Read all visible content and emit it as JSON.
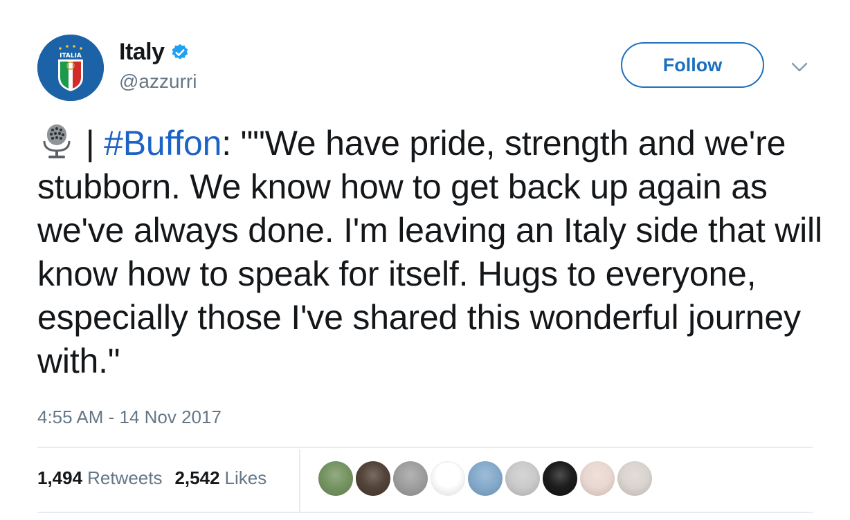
{
  "account": {
    "display_name": "Italy",
    "handle": "@azzurri",
    "avatar_text": "ITALIA",
    "verified_color": "#1da1f2"
  },
  "follow_button": {
    "label": "Follow"
  },
  "tweet": {
    "prefix": " | ",
    "hashtag": "#Buffon",
    "body": ": \"\"We have pride, strength and we're stubborn. We know how to get back up again as we've always done. I'm leaving an Italy side that will know how to speak for itself. Hugs to everyone, especially those I've shared this wonderful journey with.\"",
    "timestamp": "4:55 AM - 14 Nov 2017"
  },
  "stats": {
    "retweets_count": "1,494",
    "retweets_label": "Retweets",
    "likes_count": "2,542",
    "likes_label": "Likes"
  },
  "liker_avatars": [
    {
      "name": "liker-avatar-1",
      "color": "#6f8f5a"
    },
    {
      "name": "liker-avatar-2",
      "color": "#4a3a30"
    },
    {
      "name": "liker-avatar-3",
      "color": "#9a9a9a"
    },
    {
      "name": "liker-avatar-4",
      "color": "#ffffff"
    },
    {
      "name": "liker-avatar-5",
      "color": "#7fa6c9"
    },
    {
      "name": "liker-avatar-6",
      "color": "#c8c8c8"
    },
    {
      "name": "liker-avatar-7",
      "color": "#111111"
    },
    {
      "name": "liker-avatar-8",
      "color": "#e9d6cf"
    },
    {
      "name": "liker-avatar-9",
      "color": "#d9d2cc"
    }
  ],
  "colors": {
    "link_blue": "#1b63c6",
    "follow_blue": "#1b6fc0",
    "secondary_text": "#657786",
    "divider": "#e6ecf0"
  }
}
